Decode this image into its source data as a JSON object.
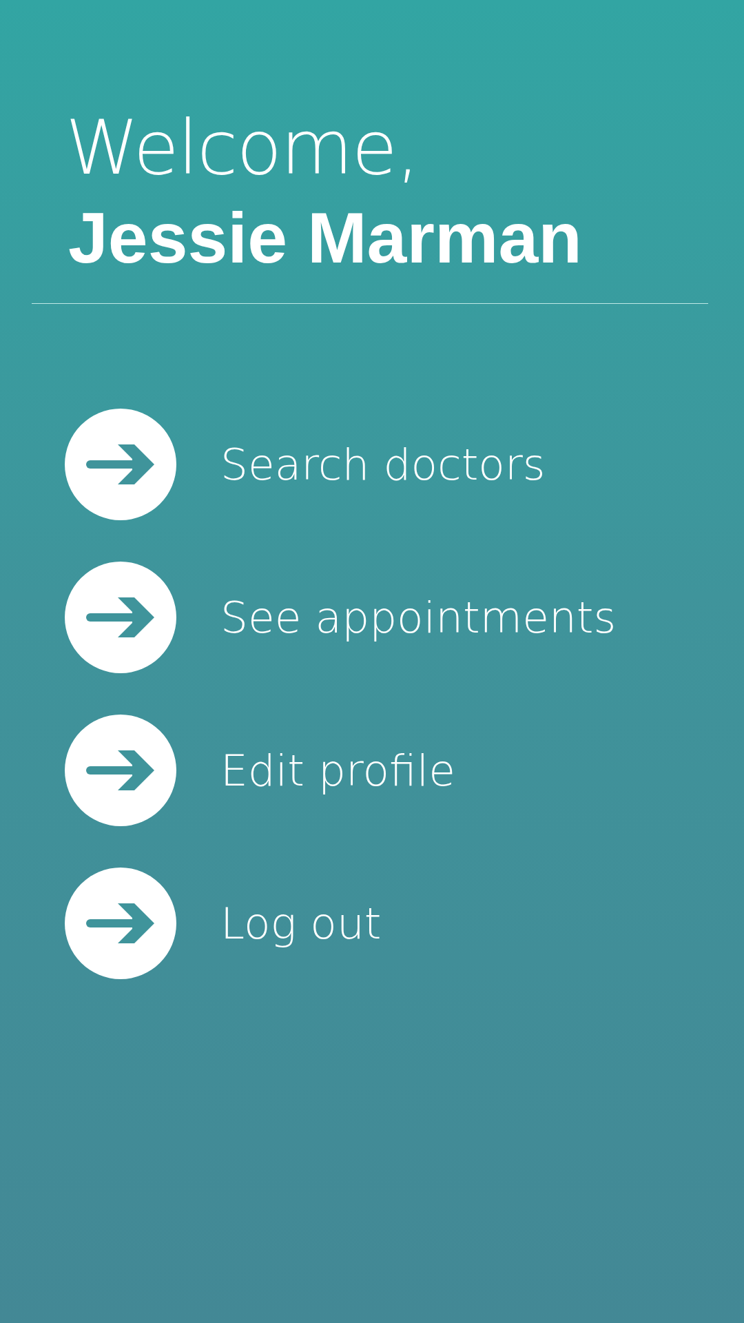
{
  "greeting": "Welcome,",
  "user_name": "Jessie Marman",
  "menu": [
    {
      "label": "Search doctors"
    },
    {
      "label": "See appointments"
    },
    {
      "label": "Edit profile"
    },
    {
      "label": "Log out"
    }
  ]
}
